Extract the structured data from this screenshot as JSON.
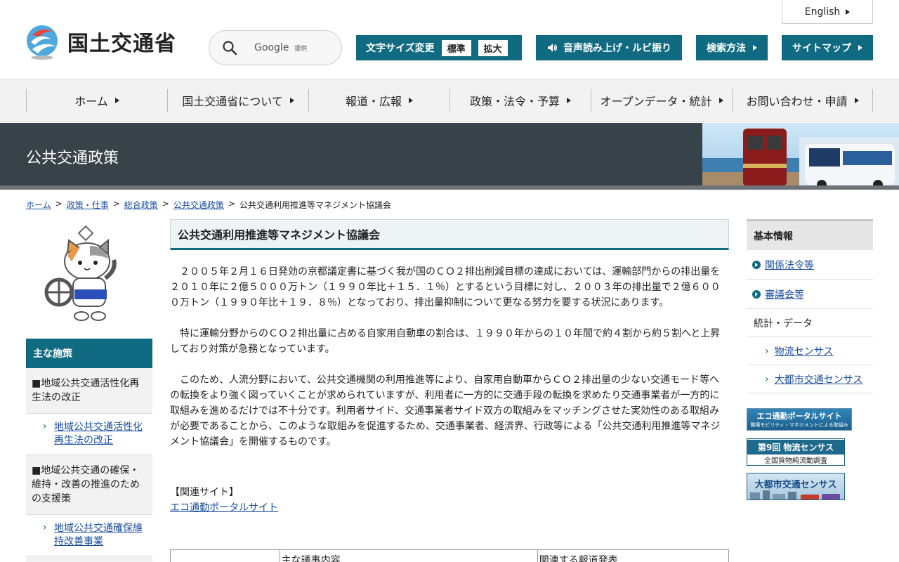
{
  "header": {
    "logo_text": "国土交通省",
    "search": {
      "google_label": "Google",
      "google_sub": "提供"
    },
    "english_label": "English",
    "font_size": {
      "label": "文字サイズ変更",
      "standard": "標準",
      "large": "拡大"
    },
    "voice_label": "音声読み上げ・ルビ振り",
    "howto_label": "検索方法",
    "sitemap_label": "サイトマップ"
  },
  "gnav": {
    "items": [
      {
        "label": "ホーム"
      },
      {
        "label": "国土交通省について"
      },
      {
        "label": "報道・広報"
      },
      {
        "label": "政策・法令・予算"
      },
      {
        "label": "オープンデータ・統計"
      },
      {
        "label": "お問い合わせ・申請"
      }
    ]
  },
  "banner": {
    "title": "公共交通政策"
  },
  "breadcrumb": {
    "items": [
      {
        "label": "ホーム"
      },
      {
        "label": "政策・仕事"
      },
      {
        "label": "総合政策"
      },
      {
        "label": "公共交通政策"
      }
    ],
    "sep": ">",
    "current": "公共交通利用推進等マネジメント協議会"
  },
  "left_nav": {
    "heading": "主な施策",
    "cat1": "■地域公共交通活性化再生法の改正",
    "sub1": "地域公共交通活性化再生法の改正",
    "cat2": "■地域公共交通の確保・維持・改善の推進のための支援策",
    "sub2": "地域公共交通確保維持改善事業"
  },
  "main": {
    "title": "公共交通利用推進等マネジメント協議会",
    "p1": "２００５年２月１６日発効の京都議定書に基づく我が国のＣＯ２排出削減目標の達成においては、運輸部門からの排出量を２０１０年に２億５０００万トン（１９９０年比＋１５．１％）とするという目標に対し、２００３年の排出量で２億６０００万トン（１９９０年比＋１９．８％）となっており、排出量抑制について更なる努力を要する状況にあります。",
    "p2": "特に運輸分野からのＣＯ２排出量に占める自家用自動車の割合は、１９９０年からの１０年間で約４割から約５割へと上昇しており対策が急務となっています。",
    "p3": "このため、人流分野において、公共交通機関の利用推進等により、自家用自動車からＣＯ２排出量の少ない交通モード等への転換をより強く図っていくことが求められていますが、利用者に一方的に交通手段の転換を求めたり交通事業者が一方的に取組みを進めるだけでは不十分です。利用者サイド、交通事業者サイド双方の取組みをマッチングさせた実効性のある取組みが必要であることから、このような取組みを促進するため、交通事業者、経済界、行政等による「公共交通利用推進等マネジメント協議会」を開催するものです。",
    "related_heading": "【関連サイト】",
    "related_link": "エコ通勤ポータルサイト",
    "table_headers": [
      "",
      "主な議事内容",
      "関連する報道発表"
    ]
  },
  "right_nav": {
    "heading": "基本情報",
    "item1": "関係法令等",
    "item2": "審議会等",
    "item3": "統計・データ",
    "sub1": "物流センサス",
    "sub2": "大都市交通センサス"
  },
  "right_banners": {
    "b1_title": "エコ通勤ポータルサイト",
    "b1_sub": "職場モビリティ・マネジメントによる取組み",
    "b2_title": "第9回 物流センサス",
    "b2_sub": "全国貨物純流動調査",
    "b3_title": "大都市交通センサス"
  },
  "colors": {
    "accent": "#106b82",
    "banner": "#384249",
    "link": "#1a4ea0"
  }
}
